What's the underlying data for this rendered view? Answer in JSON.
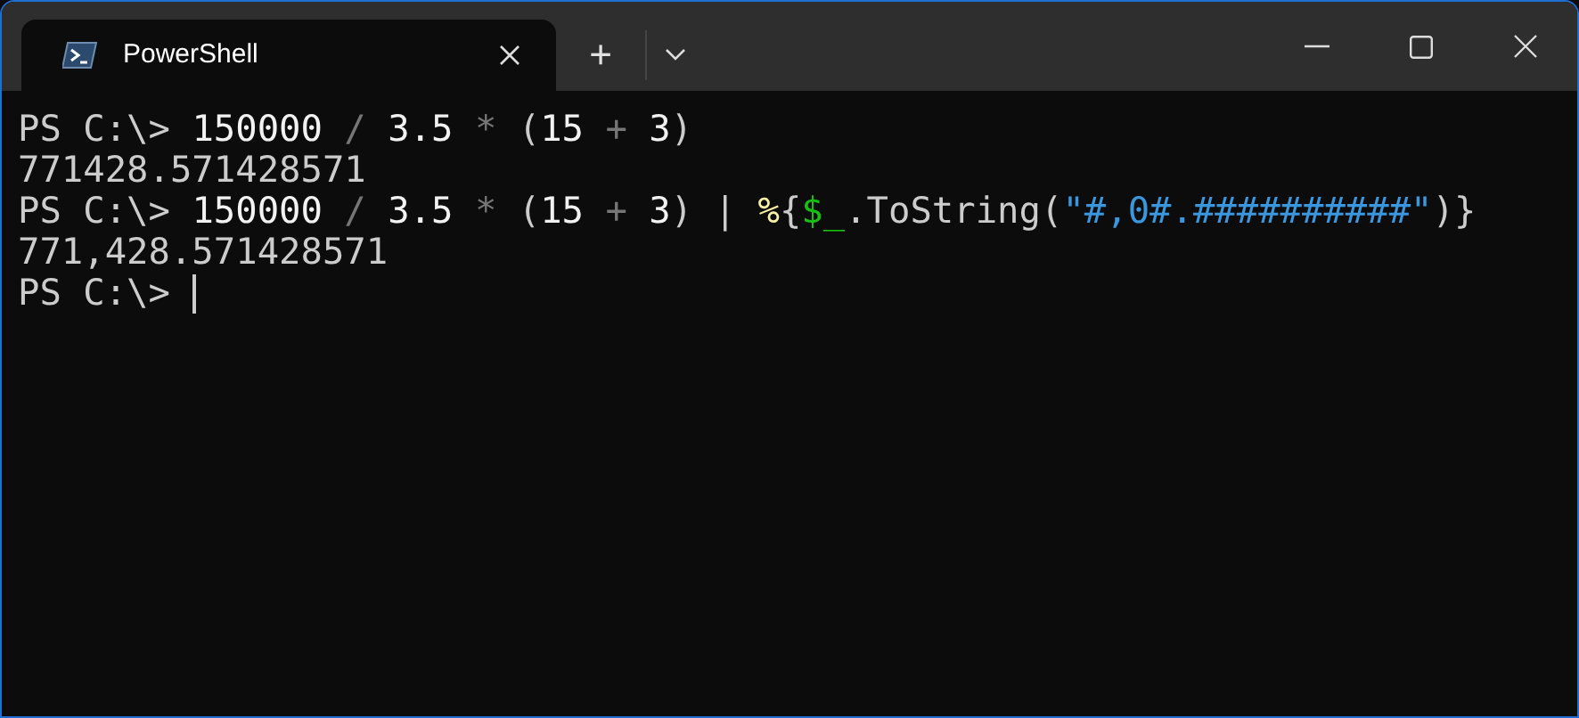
{
  "tab": {
    "title": "PowerShell",
    "selected": true
  },
  "new_tab_button": "+",
  "lines": [
    [
      {
        "kind": "prompt",
        "text": "PS C:\\> "
      },
      {
        "kind": "number",
        "text": "150000"
      },
      {
        "kind": "operator",
        "text": " / "
      },
      {
        "kind": "number",
        "text": "3.5"
      },
      {
        "kind": "operator",
        "text": " * "
      },
      {
        "kind": "plain",
        "text": "("
      },
      {
        "kind": "number",
        "text": "15"
      },
      {
        "kind": "operator",
        "text": " + "
      },
      {
        "kind": "number",
        "text": "3"
      },
      {
        "kind": "plain",
        "text": ")"
      }
    ],
    [
      {
        "kind": "output",
        "text": "771428.571428571"
      }
    ],
    [
      {
        "kind": "prompt",
        "text": "PS C:\\> "
      },
      {
        "kind": "number",
        "text": "150000"
      },
      {
        "kind": "operator",
        "text": " / "
      },
      {
        "kind": "number",
        "text": "3.5"
      },
      {
        "kind": "operator",
        "text": " * "
      },
      {
        "kind": "plain",
        "text": "("
      },
      {
        "kind": "number",
        "text": "15"
      },
      {
        "kind": "operator",
        "text": " + "
      },
      {
        "kind": "number",
        "text": "3"
      },
      {
        "kind": "plain",
        "text": ") "
      },
      {
        "kind": "plain",
        "text": "| "
      },
      {
        "kind": "alias",
        "text": "%"
      },
      {
        "kind": "plain",
        "text": "{"
      },
      {
        "kind": "variable",
        "text": "$_"
      },
      {
        "kind": "plain",
        "text": ".ToString("
      },
      {
        "kind": "string",
        "text": "\"#,0#.##########\""
      },
      {
        "kind": "plain",
        "text": ")}"
      }
    ],
    [
      {
        "kind": "output",
        "text": "771,428.571428571"
      }
    ],
    [
      {
        "kind": "prompt",
        "text": "PS C:\\> "
      }
    ]
  ]
}
